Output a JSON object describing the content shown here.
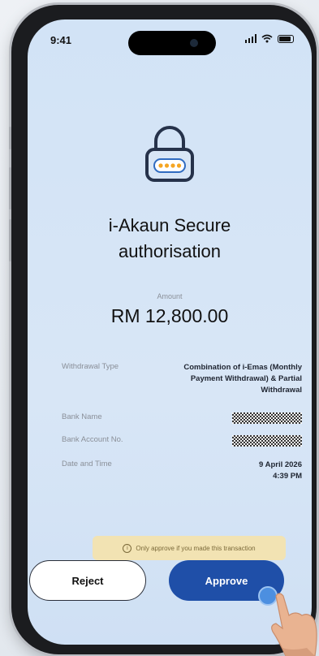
{
  "status": {
    "time": "9:41"
  },
  "screen": {
    "title": "i-Akaun Secure authorisation",
    "amount_label": "Amount",
    "amount": "RM 12,800.00"
  },
  "details": {
    "withdrawal_type_label": "Withdrawal Type",
    "withdrawal_type_value": "Combination of i-Emas (Monthly Payment Withdrawal) & Partial Withdrawal",
    "bank_name_label": "Bank Name",
    "bank_account_label": "Bank Account No.",
    "datetime_label": "Date and Time",
    "date_value": "9 April 2026",
    "time_value": "4:39 PM"
  },
  "warning": {
    "icon": "info-icon",
    "text": "Only approve if you made this transaction"
  },
  "actions": {
    "reject_label": "Reject",
    "approve_label": "Approve"
  },
  "colors": {
    "approve": "#1f4fa8",
    "accent": "#f5a623",
    "warning_bg": "#f2e3b3"
  }
}
